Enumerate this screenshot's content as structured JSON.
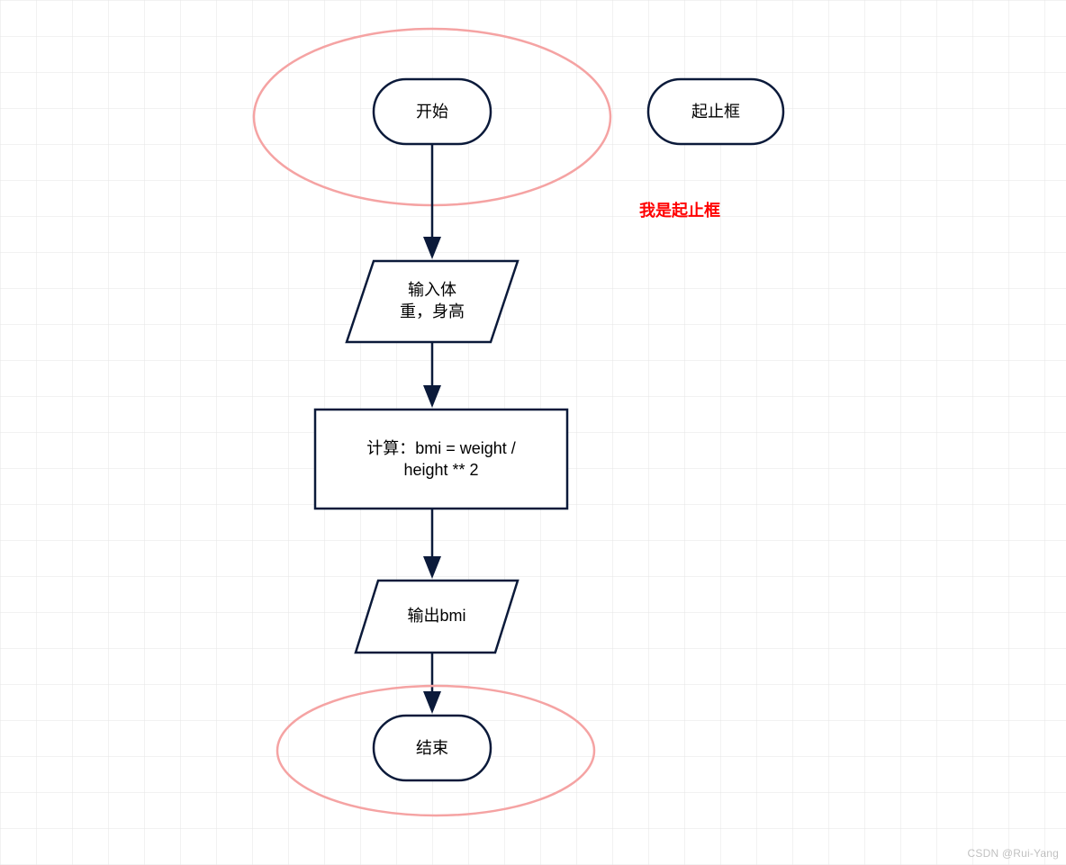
{
  "flow": {
    "start": "开始",
    "input": "输入体\n重，身高",
    "process": "计算：bmi = weight /\nheight ** 2",
    "output": "输出bmi",
    "end": "结束"
  },
  "legend": {
    "terminal_box": "起止框",
    "annotation": "我是起止框"
  },
  "colors": {
    "shape_stroke": "#0b1a3a",
    "highlight": "#f5a3a3",
    "grid": "#e4e4e4",
    "annotation_text": "#ff0000"
  },
  "watermark": "CSDN @Rui-Yang"
}
